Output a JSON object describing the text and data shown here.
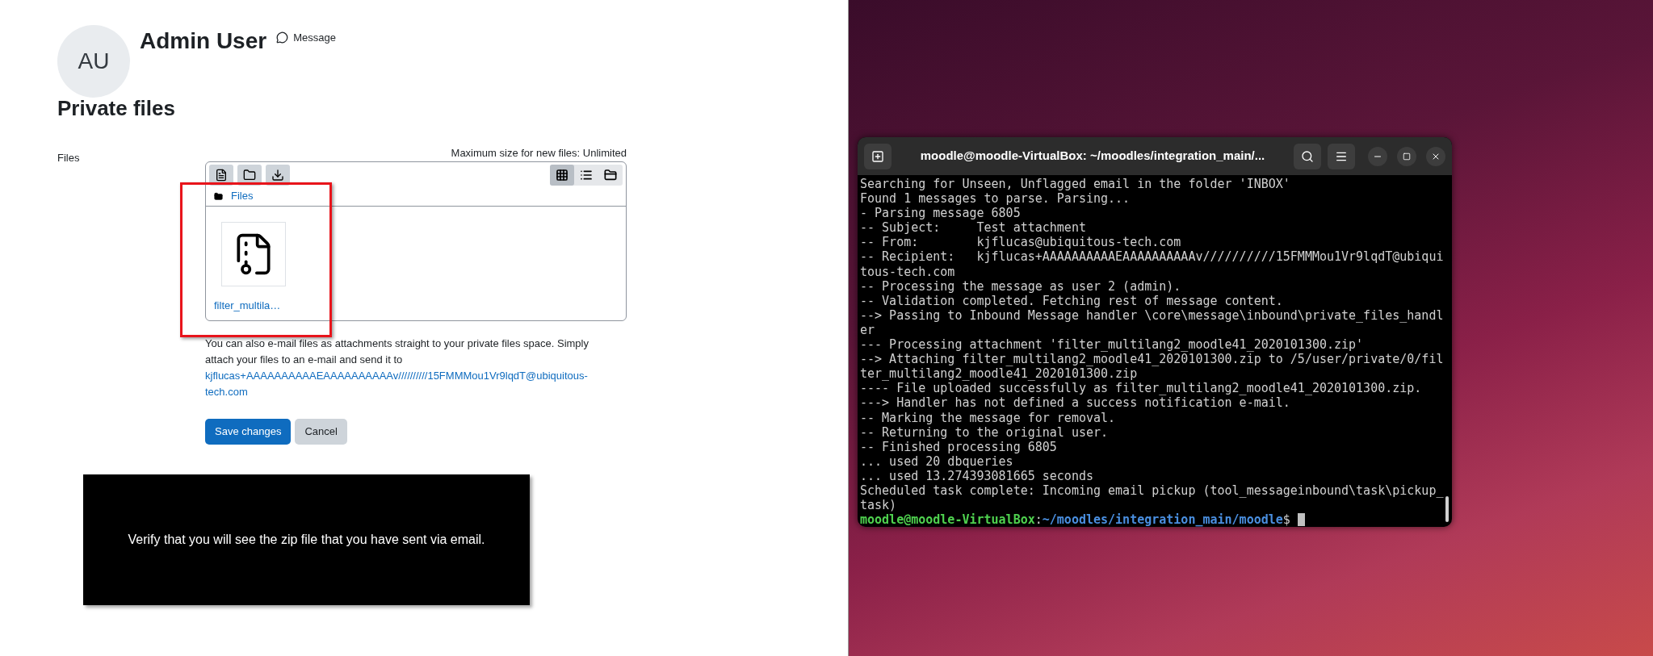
{
  "profile": {
    "initials": "AU",
    "name": "Admin User",
    "message_link": "Message"
  },
  "page_title": "Private files",
  "files_field": {
    "label": "Files",
    "max_size": "Maximum size for new files: Unlimited",
    "toolbar_left": [
      {
        "kind": "file"
      },
      {
        "kind": "folder"
      },
      {
        "kind": "download"
      }
    ],
    "view_modes": [
      {
        "kind": "grid",
        "selected": true
      },
      {
        "kind": "list",
        "selected": false
      },
      {
        "kind": "tree",
        "selected": false
      }
    ],
    "breadcrumb": "Files",
    "files": [
      {
        "name": "filter_multila…",
        "kind": "zip"
      }
    ],
    "highlight": true
  },
  "help_text": "You can also e-mail files as attachments straight to your private files space. Simply attach your files to an e-mail and send it to",
  "email_link": "kjflucas+AAAAAAAAAAEAAAAAAAAAAv//////////15FMMMou1Vr9lqdT@ubiquitous-tech.com",
  "buttons": [
    {
      "label": "Save changes",
      "kind": "primary"
    },
    {
      "label": "Cancel",
      "kind": "secondary"
    }
  ],
  "caption": "Verify that you will see the zip file that you have sent via email.",
  "terminal": {
    "title": "moodle@moodle-VirtualBox: ~/moodles/integration_main/...",
    "lines": [
      "Searching for Unseen, Unflagged email in the folder 'INBOX'",
      "Found 1 messages to parse. Parsing...",
      "- Parsing message 6805",
      "-- Subject:     Test attachment",
      "-- From:        kjflucas@ubiquitous-tech.com",
      "-- Recipient:   kjflucas+AAAAAAAAAAEAAAAAAAAAAv//////////15FMMMou1Vr9lqdT@ubiqui",
      "tous-tech.com",
      "-- Processing the message as user 2 (admin).",
      "-- Validation completed. Fetching rest of message content.",
      "--> Passing to Inbound Message handler \\core\\message\\inbound\\private_files_handl",
      "er",
      "--- Processing attachment 'filter_multilang2_moodle41_2020101300.zip'",
      "--> Attaching filter_multilang2_moodle41_2020101300.zip to /5/user/private/0/fil",
      "ter_multilang2_moodle41_2020101300.zip",
      "---- File uploaded successfully as filter_multilang2_moodle41_2020101300.zip.",
      "---> Handler has not defined a success notification e-mail.",
      "-- Marking the message for removal.",
      "-- Returning to the original user.",
      "-- Finished processing 6805",
      "... used 20 dbqueries",
      "... used 13.274393081665 seconds",
      "Scheduled task complete: Incoming email pickup (tool_messageinbound\\task\\pickup_",
      "task)"
    ],
    "prompt": {
      "user": "moodle@moodle-VirtualBox",
      "separator": ":",
      "path": "~/moodles/integration_main/moodle",
      "symbol": "$"
    }
  }
}
